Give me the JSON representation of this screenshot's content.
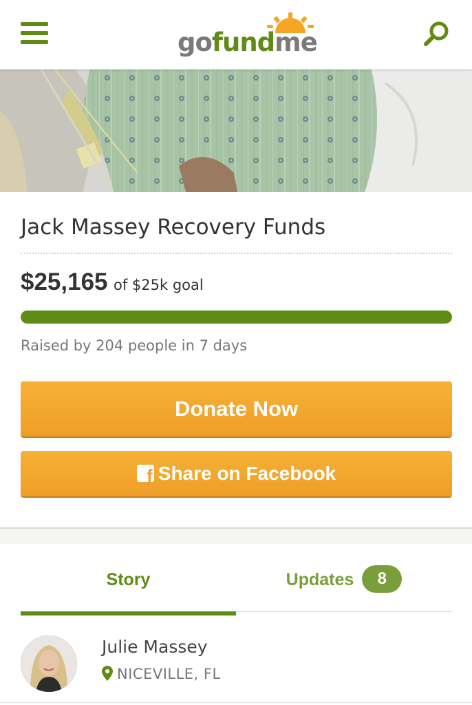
{
  "header": {
    "logo": {
      "part1": "go",
      "part2": "fund",
      "part3": "me"
    },
    "menu_icon": "hamburger-menu-icon",
    "search_icon": "search-icon"
  },
  "campaign": {
    "title": "Jack Massey Recovery Funds",
    "amount_raised": "$25,165",
    "goal_text": "of $25k goal",
    "progress_fraction": 1.0,
    "raised_by": "Raised by 204 people in 7 days"
  },
  "actions": {
    "donate_label": "Donate Now",
    "share_label": "Share on Facebook",
    "share_icon": "facebook-icon"
  },
  "tabs": [
    {
      "label": "Story",
      "active": true
    },
    {
      "label": "Updates",
      "badge": "8",
      "active": false
    }
  ],
  "organizer": {
    "name": "Julie Massey",
    "location": "NICEVILLE, FL",
    "location_icon": "map-pin-icon"
  },
  "colors": {
    "brand_green": "#5e8c15",
    "button_orange": "#f3a530",
    "badge_green": "#7a9f3a"
  }
}
